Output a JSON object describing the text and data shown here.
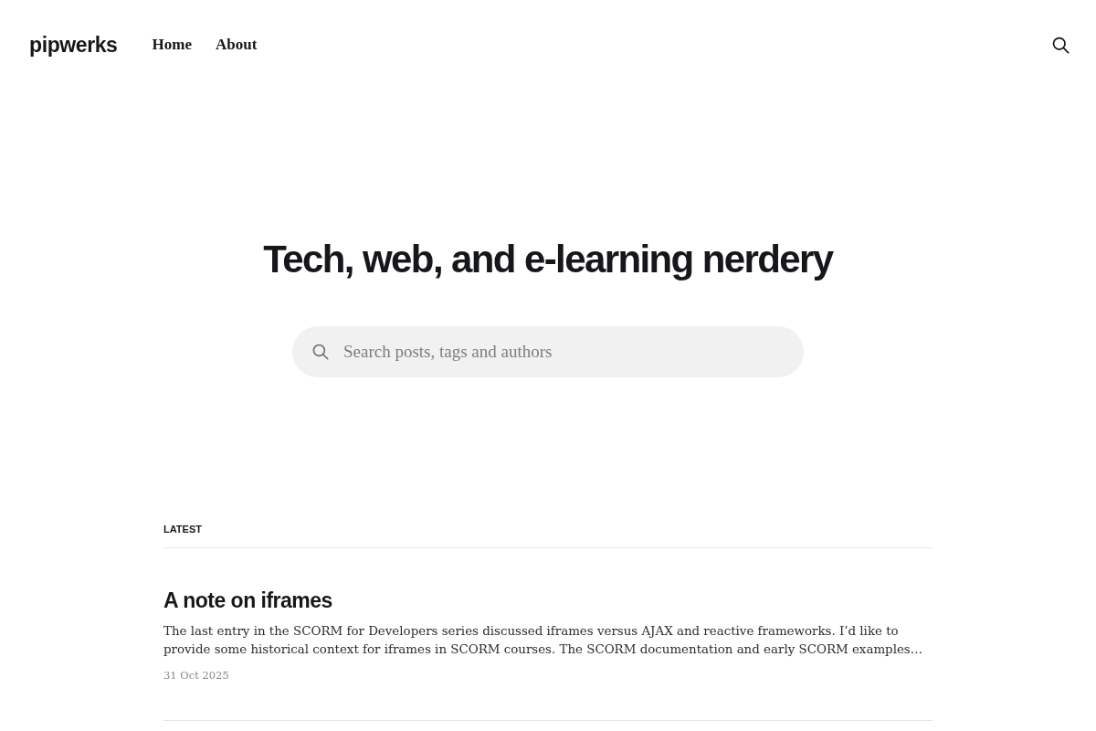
{
  "header": {
    "logo": "pipwerks",
    "nav": [
      {
        "label": "Home"
      },
      {
        "label": "About"
      }
    ]
  },
  "hero": {
    "title": "Tech, web, and e-learning nerdery",
    "search": {
      "placeholder": "Search posts, tags and authors"
    }
  },
  "latest": {
    "heading": "LATEST",
    "posts": [
      {
        "title": "A note on iframes",
        "excerpt": "The last entry in the SCORM for Developers series discussed iframes versus AJAX and reactive frameworks. I’d like to provide some historical context for iframes in SCORM courses. The SCORM documentation and early SCORM examples…",
        "date": "31 Oct 2025"
      }
    ]
  }
}
